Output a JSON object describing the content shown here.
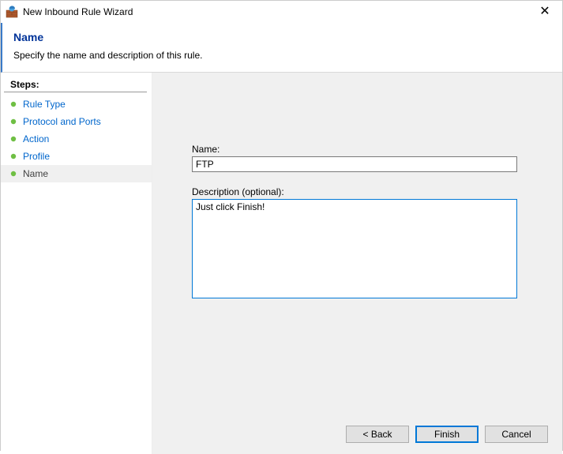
{
  "window": {
    "title": "New Inbound Rule Wizard"
  },
  "header": {
    "title": "Name",
    "subtitle": "Specify the name and description of this rule."
  },
  "sidebar": {
    "heading": "Steps:",
    "items": [
      {
        "label": "Rule Type"
      },
      {
        "label": "Protocol and Ports"
      },
      {
        "label": "Action"
      },
      {
        "label": "Profile"
      },
      {
        "label": "Name"
      }
    ]
  },
  "form": {
    "name_label": "Name:",
    "name_value": "FTP",
    "desc_label": "Description (optional):",
    "desc_value": "Just click Finish!"
  },
  "buttons": {
    "back": "< Back",
    "finish": "Finish",
    "cancel": "Cancel"
  }
}
